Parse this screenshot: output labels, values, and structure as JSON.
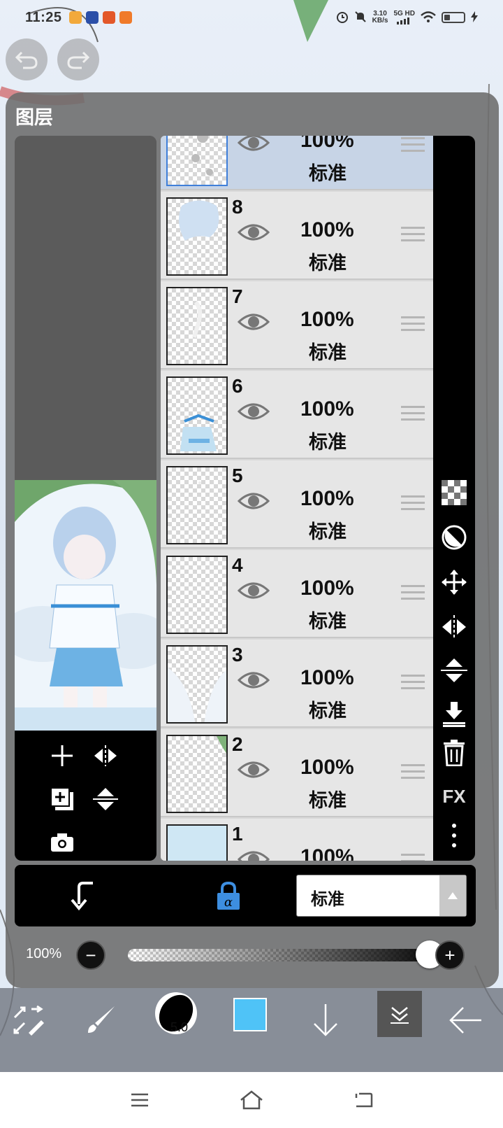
{
  "status_bar": {
    "time": "11:25",
    "network_speed_value": "3.10",
    "network_speed_unit": "KB/s",
    "network_type": "5G HD",
    "icons": [
      "alarm-icon",
      "mute-icon",
      "signal-icon",
      "wifi-icon",
      "battery-icon",
      "charging-icon"
    ],
    "battery_level": 0.3
  },
  "canvas": {
    "undo_icon": "undo-icon",
    "redo_icon": "redo-icon"
  },
  "layer_panel": {
    "title": "图层",
    "layers": [
      {
        "number": "",
        "opacity": "100%",
        "blend": "标准",
        "selected": true
      },
      {
        "number": "8",
        "opacity": "100%",
        "blend": "标准",
        "selected": false
      },
      {
        "number": "7",
        "opacity": "100%",
        "blend": "标准",
        "selected": false
      },
      {
        "number": "6",
        "opacity": "100%",
        "blend": "标准",
        "selected": false
      },
      {
        "number": "5",
        "opacity": "100%",
        "blend": "标准",
        "selected": false
      },
      {
        "number": "4",
        "opacity": "100%",
        "blend": "标准",
        "selected": false
      },
      {
        "number": "3",
        "opacity": "100%",
        "blend": "标准",
        "selected": false
      },
      {
        "number": "2",
        "opacity": "100%",
        "blend": "标准",
        "selected": false
      },
      {
        "number": "1",
        "opacity": "100%",
        "blend": "标准",
        "selected": false
      }
    ],
    "preview_tools": [
      "add-layer-icon",
      "flip-horizontal-icon",
      "duplicate-layer-icon",
      "flip-vertical-icon",
      "camera-icon"
    ],
    "right_tools": {
      "transparency": "checkerboard-icon",
      "invert": "contrast-icon",
      "move": "move-icon",
      "flip_h": "flip-horizontal-icon",
      "flip_v": "flip-vertical-icon",
      "merge_down": "merge-down-icon",
      "delete": "trash-icon",
      "fx_label": "FX",
      "more": "more-vertical-icon"
    },
    "blend_bar": {
      "clip_icon": "clipping-icon",
      "alpha_lock_icon": "alpha-lock-icon",
      "blend_mode": "标准"
    },
    "opacity": {
      "label": "100%",
      "minus": "−",
      "plus": "+",
      "value_fraction": 1.0
    }
  },
  "bottom_toolbar": {
    "brush_size": "5.0",
    "color": "#4fc3f7",
    "icons": [
      "transform-icon",
      "brush-icon",
      "brush-size-icon",
      "color-icon",
      "arrow-down-icon",
      "layers-icon",
      "back-arrow-icon"
    ]
  },
  "nav_bar": {
    "icons": [
      "menu-icon",
      "home-icon",
      "back-icon"
    ]
  }
}
